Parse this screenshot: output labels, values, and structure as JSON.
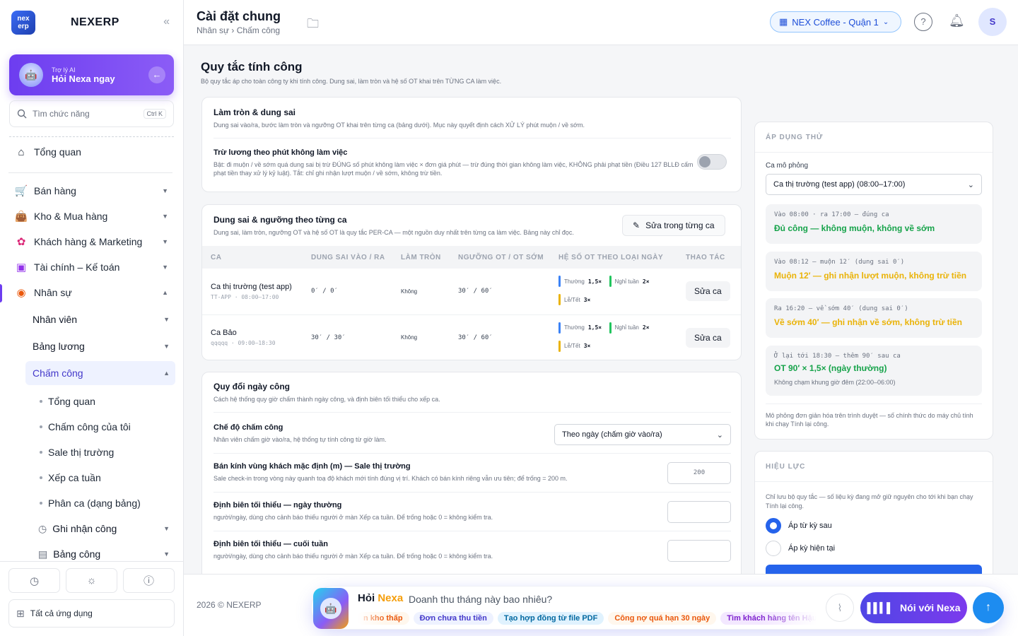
{
  "app": {
    "logo_text": "nex erp",
    "name": "NEXERP"
  },
  "ai": {
    "small": "Trợ lý AI",
    "big": "Hỏi Nexa ngay"
  },
  "search": {
    "label": "Tìm chức năng",
    "shortcut": "Ctrl K"
  },
  "nav": {
    "overview": "Tổng quan",
    "sales": "Bán hàng",
    "inventory": "Kho & Mua hàng",
    "crm": "Khách hàng & Marketing",
    "finance": "Tài chính – Kế toán",
    "hr": "Nhân sự",
    "employees": "Nhân viên",
    "payroll": "Bảng lương",
    "attendance": "Chấm công",
    "leaf": [
      "Tổng quan",
      "Chấm công của tôi",
      "Sale thị trường",
      "Xếp ca tuần",
      "Phân ca (dạng bảng)"
    ],
    "record": "Ghi nhận công",
    "timesheet": "Bảng công",
    "all_apps": "Tất cả ứng dụng"
  },
  "header": {
    "title": "Cài đặt chung",
    "crumb": "Nhân sự › Chấm công",
    "branch": "NEX Coffee - Quận 1",
    "user_initial": "S"
  },
  "page": {
    "title": "Quy tắc tính công",
    "subtitle": "Bộ quy tắc áp cho toàn công ty khi tính công. Dung sai, làm tròn và hệ số OT khai trên TỪNG CA làm việc."
  },
  "rounding": {
    "title": "Làm tròn & dung sai",
    "desc": "Dung sai vào/ra, bước làm tròn và ngưỡng OT khai trên từng ca (bảng dưới). Mục này quyết định cách XỬ LÝ phút muộn / về sớm.",
    "deduct_title": "Trừ lương theo phút không làm việc",
    "deduct_desc": "Bật: đi muộn / về sớm quá dung sai bị trừ ĐÚNG số phút không làm việc × đơn giá phút — trừ đúng thời gian không làm việc, KHÔNG phải phạt tiền (Điều 127 BLLĐ cấm phạt tiền thay xử lý kỷ luật). Tắt: chỉ ghi nhận lượt muộn / về sớm, không trừ tiền."
  },
  "shift_table": {
    "title": "Dung sai & ngưỡng theo từng ca",
    "desc": "Dung sai, làm tròn, ngưỡng OT và hệ số OT là quy tắc PER-CA — một nguồn duy nhất trên từng ca làm việc. Bảng này chỉ đọc.",
    "edit_btn": "Sửa trong từng ca",
    "columns": [
      "CA",
      "DUNG SAI VÀO / RA",
      "LÀM TRÒN",
      "NGƯỠNG OT / OT SỚM",
      "HỆ SỐ OT THEO LOẠI NGÀY",
      "THAO TÁC"
    ],
    "rows": [
      {
        "name": "Ca thị trường (test app)",
        "meta": "TT-APP · 08:00–17:00",
        "tolerance": "0′ / 0′",
        "rounding": "Không",
        "ot": "30′ / 60′",
        "weekday_label": "Thường",
        "weekday": "1,5×",
        "weekend_label": "Nghỉ tuần",
        "weekend": "2×",
        "holiday_label": "Lễ/Tết",
        "holiday": "3×",
        "action": "Sửa ca"
      },
      {
        "name": "Ca Bảo",
        "meta": "qqqqq · 09:00–18:30",
        "tolerance": "30′ / 30′",
        "rounding": "Không",
        "ot": "30′ / 60′",
        "weekday_label": "Thường",
        "weekday": "1,5×",
        "weekend_label": "Nghỉ tuần",
        "weekend": "2×",
        "holiday_label": "Lễ/Tết",
        "holiday": "3×",
        "action": "Sửa ca"
      }
    ]
  },
  "workday": {
    "title": "Quy đổi ngày công",
    "desc": "Cách hệ thống quy giờ chấm thành ngày công, và định biên tối thiểu cho xếp ca.",
    "mode_title": "Chế độ chấm công",
    "mode_desc": "Nhân viên chấm giờ vào/ra, hệ thống tự tính công từ giờ làm.",
    "mode_value": "Theo ngày (chấm giờ vào/ra)",
    "radius_title": "Bán kính vùng khách mặc định (m) — Sale thị trường",
    "radius_desc": "Sale check-in trong vòng này quanh toạ độ khách mới tính đúng vị trí. Khách có bán kính riêng vẫn ưu tiên; để trống = 200 m.",
    "radius_placeholder": "200",
    "min_weekday_title": "Định biên tối thiểu — ngày thường",
    "min_weekday_desc": "người/ngày, dùng cho cảnh báo thiếu người ở màn Xếp ca tuần. Để trống hoặc 0 = không kiểm tra.",
    "min_weekend_title": "Định biên tối thiểu — cuối tuần",
    "min_weekend_desc": "người/ngày, dùng cho cảnh báo thiếu người ở màn Xếp ca tuần. Để trống hoặc 0 = không kiểm tra."
  },
  "trial": {
    "label": "ÁP DỤNG THỬ",
    "shift_label": "Ca mô phỏng",
    "shift_value": "Ca thị trường (test app) (08:00–17:00)",
    "cases": [
      {
        "line1": "Vào 08:00 · ra 17:00 — đúng ca",
        "line2": "Đủ công — không muộn, không về sớm",
        "color": "#16a34a"
      },
      {
        "line1": "Vào 08:12 — muộn 12′ (dung sai 0′)",
        "line2": "Muộn 12′ — ghi nhận lượt muộn, không trừ tiền",
        "color": "#eab308"
      },
      {
        "line1": "Ra 16:20 — về sớm 40′ (dung sai 0′)",
        "line2": "Về sớm 40′ — ghi nhận về sớm, không trừ tiền",
        "color": "#eab308"
      },
      {
        "line1": "Ở lại tới 18:30 — thêm 90′ sau ca",
        "line2": "OT 90′ × 1,5× (ngày thường)",
        "line3": "Không chạm khung giờ đêm (22:00–06:00)",
        "color": "#16a34a"
      }
    ],
    "note": "Mô phỏng đơn giản hóa trên trình duyệt — số chính thức do máy chủ tính khi chạy Tính lại công."
  },
  "effect": {
    "label": "HIỆU LỰC",
    "desc": "Chỉ lưu bộ quy tắc — số liệu kỳ đang mở giữ nguyên cho tới khi bạn chạy Tính lại công.",
    "option_next": "Áp từ kỳ sau",
    "option_current": "Áp kỳ hiện tại",
    "selected": "next"
  },
  "footer": {
    "copyright": "2026 © NEXERP",
    "ask_prefix": "Hỏi",
    "ask_brand": "Nexa",
    "question": "Doanh thu tháng này bao nhiêu?",
    "chips": [
      {
        "text": "n kho thấp",
        "bg": "#fff7ed",
        "fg": "#ea580c"
      },
      {
        "text": "Đơn chưa thu tiền",
        "bg": "#eef2ff",
        "fg": "#4338ca"
      },
      {
        "text": "Tạo hợp đồng từ file PDF",
        "bg": "#e0f2fe",
        "fg": "#0369a1"
      },
      {
        "text": "Công nợ quá hạn 30 ngày",
        "bg": "#fff7ed",
        "fg": "#ea580c"
      },
      {
        "text": "Tìm khách hàng tên Hậu",
        "bg": "#f3e8ff",
        "fg": "#7e22ce"
      }
    ],
    "talk": "Nói với Nexa"
  }
}
